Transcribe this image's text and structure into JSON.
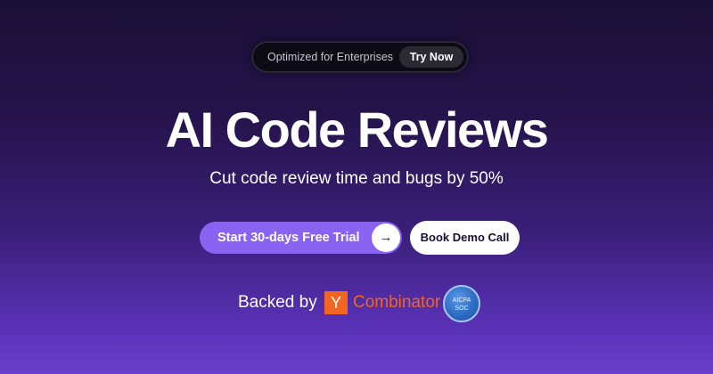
{
  "banner": {
    "text": "Optimized for Enterprises",
    "button_label": "Try Now"
  },
  "hero": {
    "title": "AI Code Reviews",
    "subtitle": "Cut code review time and bugs by 50%"
  },
  "cta": {
    "primary_label": "Start 30-days Free Trial",
    "primary_icon": "arrow-right-icon",
    "secondary_label": "Book Demo Call"
  },
  "trust": {
    "backed_label": "Backed by",
    "yc_letter": "Y",
    "yc_name": "Combinator",
    "badge_line1": "AICPA",
    "badge_line2": "SOC"
  },
  "colors": {
    "primary_purple": "#8a63f2",
    "yc_orange": "#f26522",
    "badge_blue": "#2e6cc4"
  }
}
